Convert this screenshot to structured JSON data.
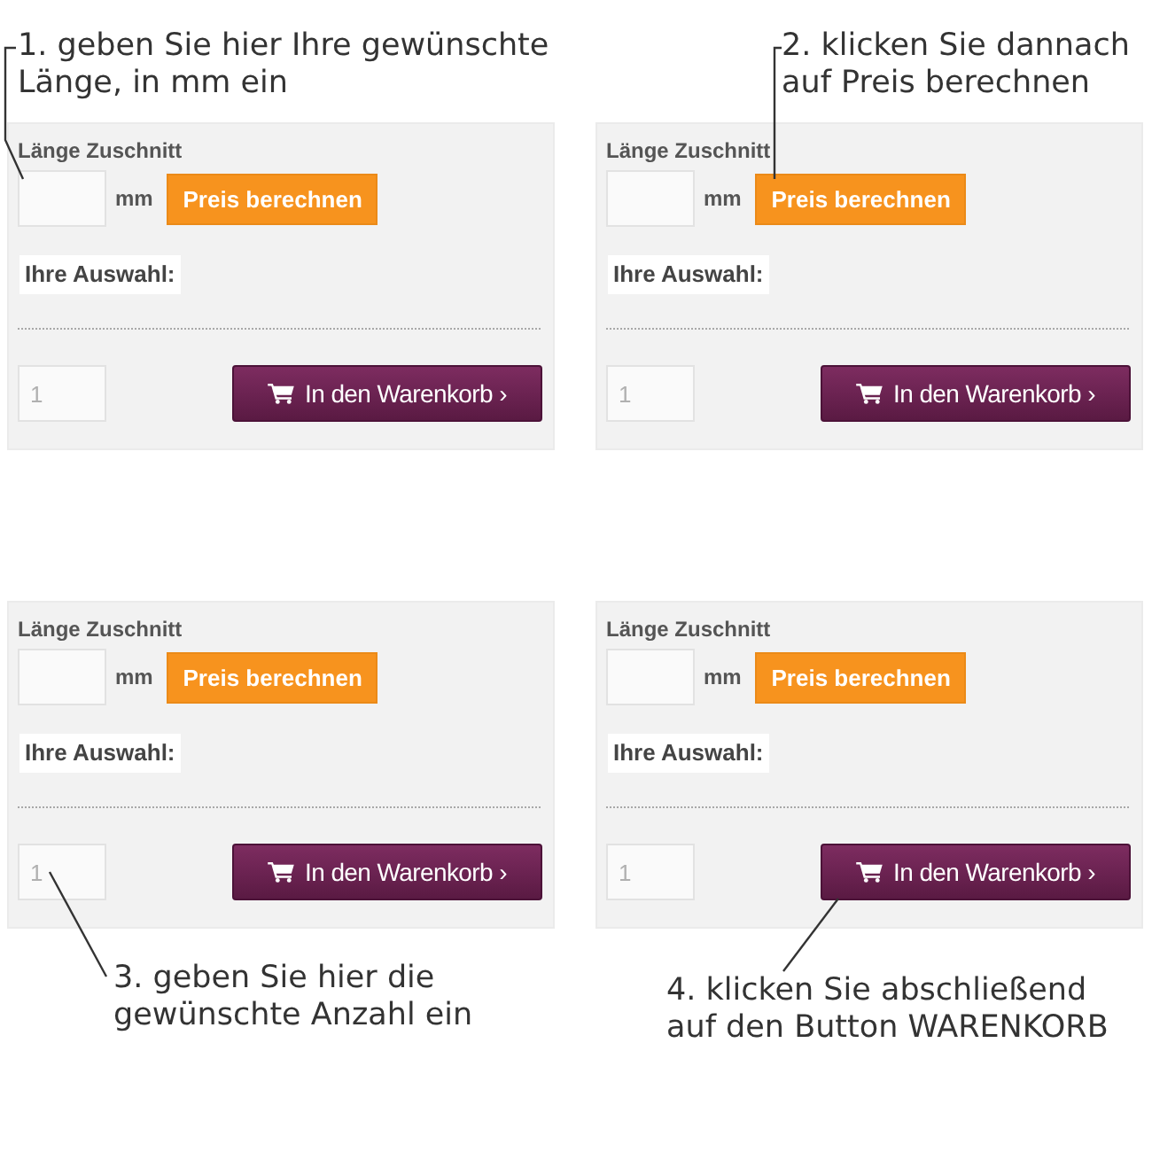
{
  "steps": [
    {
      "kind": "length",
      "caption_lines": [
        "1. geben Sie hier Ihre gewünschte",
        "Länge, in mm ein"
      ],
      "form": {
        "length_label": "Länge Zuschnitt",
        "unit": "mm",
        "price_button": "Preis berechnen",
        "selection_label": "Ihre Auswahl:",
        "quantity": "1",
        "cart_button": "In den Warenkorb ›"
      }
    },
    {
      "kind": "price",
      "caption_lines": [
        "2. klicken Sie dannach",
        "auf Preis berechnen"
      ],
      "form": {
        "length_label": "Länge Zuschnitt",
        "unit": "mm",
        "price_button": "Preis berechnen",
        "selection_label": "Ihre Auswahl:",
        "quantity": "1",
        "cart_button": "In den Warenkorb ›"
      }
    },
    {
      "kind": "quantity",
      "caption_lines": [
        "3. geben Sie hier die",
        "gewünschte Anzahl ein"
      ],
      "form": {
        "length_label": "Länge Zuschnitt",
        "unit": "mm",
        "price_button": "Preis berechnen",
        "selection_label": "Ihre Auswahl:",
        "quantity": "1",
        "cart_button": "In den Warenkorb ›"
      }
    },
    {
      "kind": "cart",
      "caption_lines": [
        "4. klicken Sie abschließend",
        "auf den Button WARENKORB"
      ],
      "form": {
        "length_label": "Länge Zuschnitt",
        "unit": "mm",
        "price_button": "Preis berechnen",
        "selection_label": "Ihre Auswahl:",
        "quantity": "1",
        "cart_button": "In den Warenkorb ›"
      }
    }
  ]
}
